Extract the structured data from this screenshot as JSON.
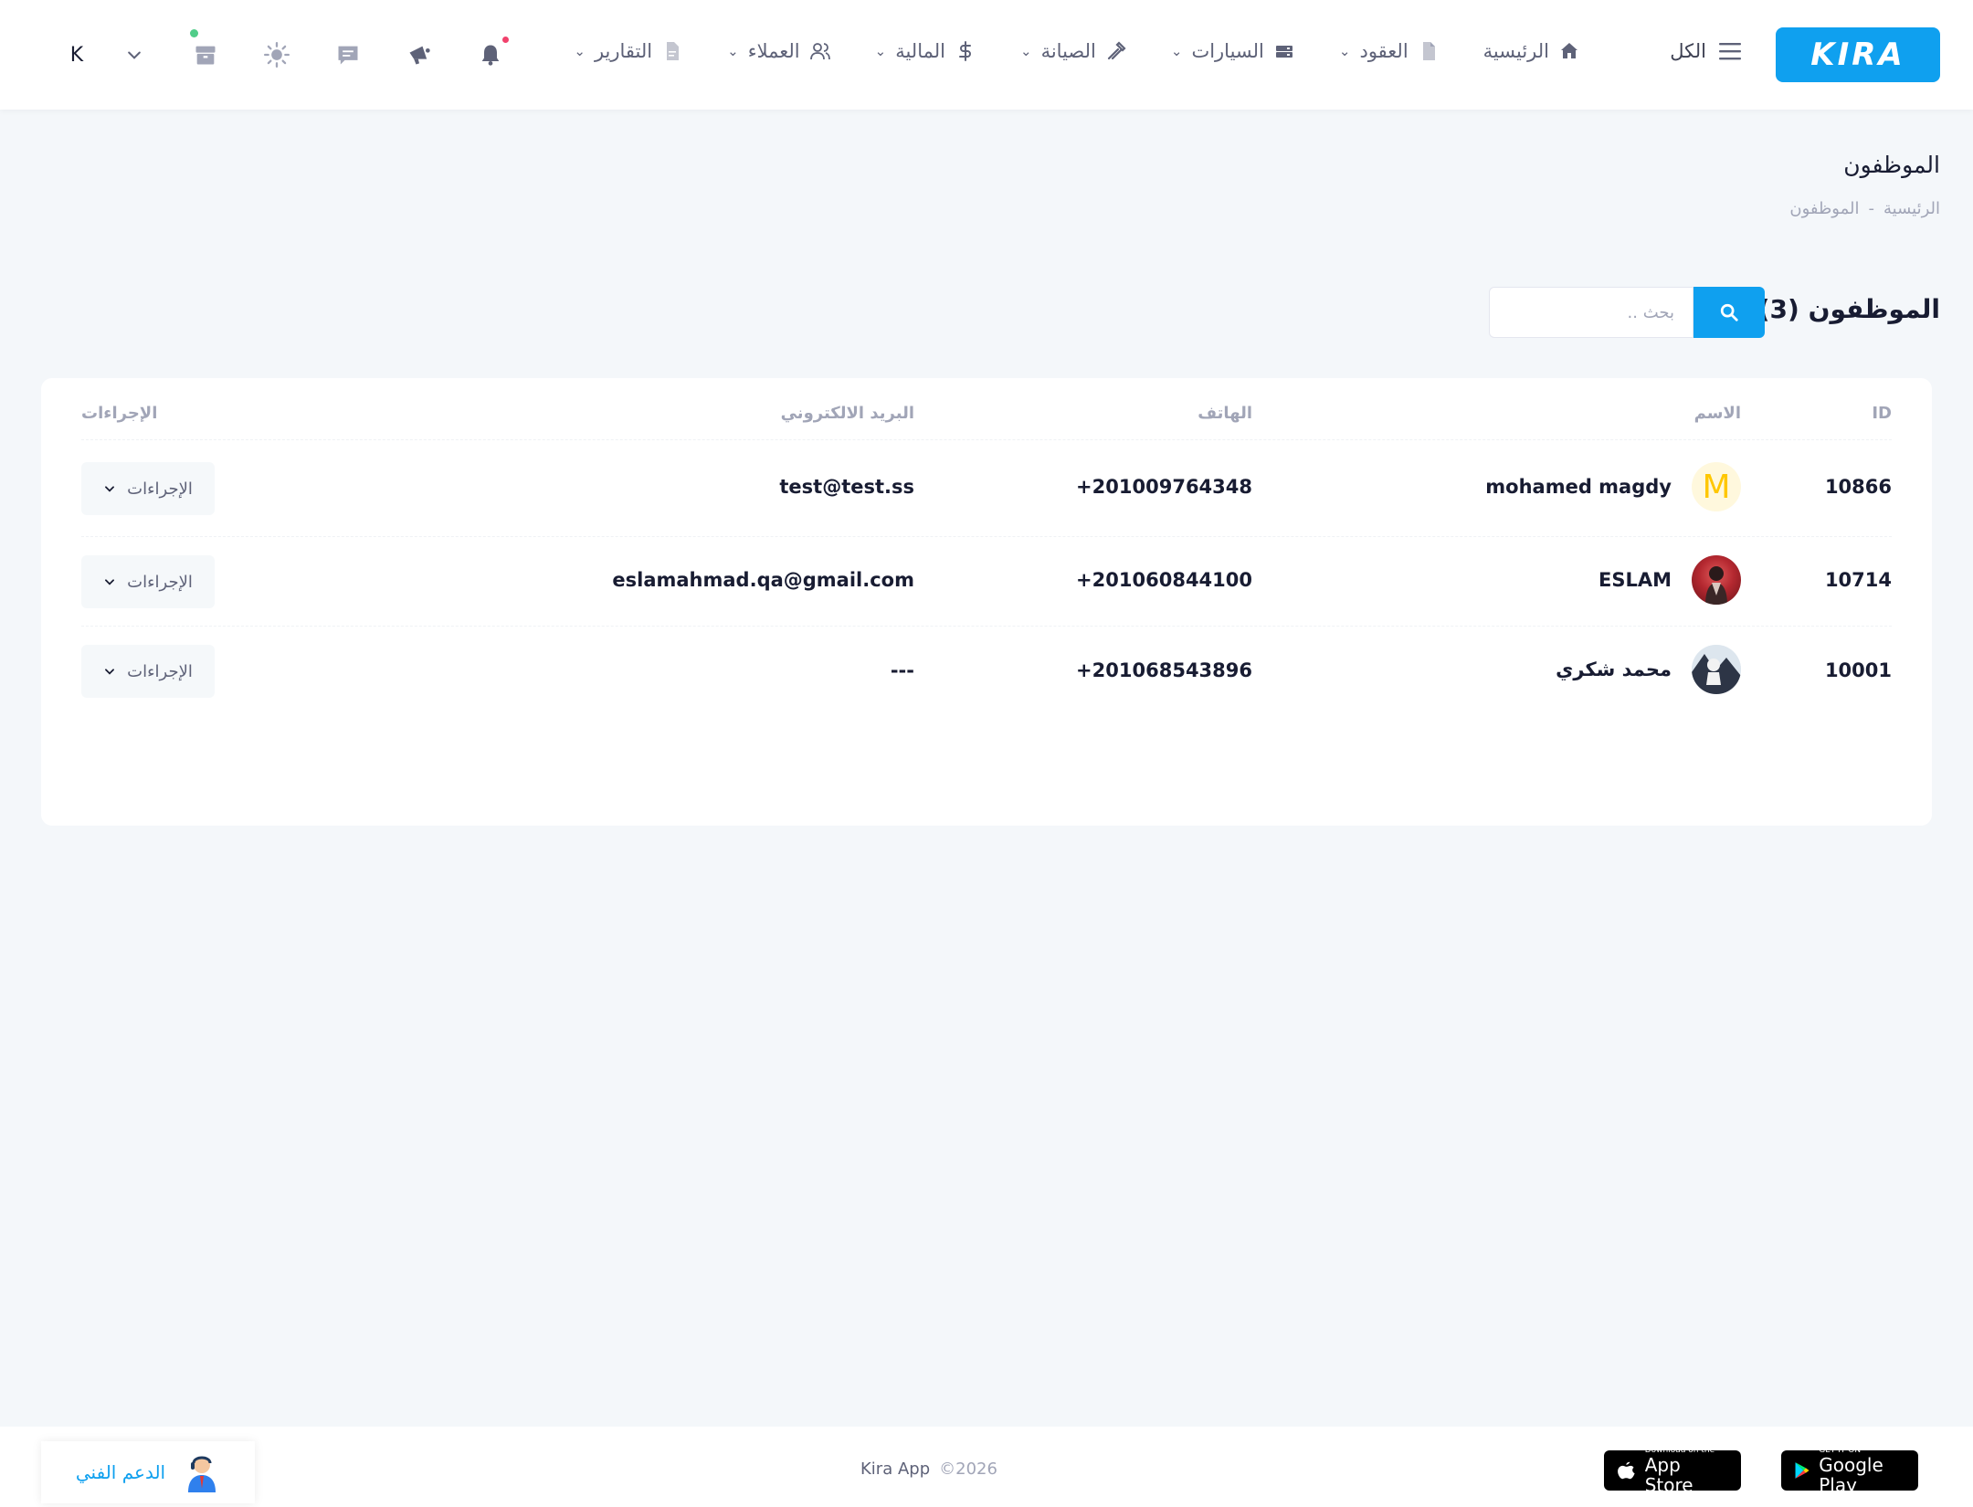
{
  "header": {
    "logo_text": "KIRA",
    "all_label": "الكل",
    "user_initial": "K",
    "nav": [
      {
        "label": "الرئيسية",
        "icon": "home-icon",
        "has_dropdown": false
      },
      {
        "label": "العقود",
        "icon": "document-icon",
        "has_dropdown": true
      },
      {
        "label": "السيارات",
        "icon": "car-icon",
        "has_dropdown": true
      },
      {
        "label": "الصيانة",
        "icon": "wrench-icon",
        "has_dropdown": true
      },
      {
        "label": "المالية",
        "icon": "dollar-icon",
        "has_dropdown": true
      },
      {
        "label": "العملاء",
        "icon": "users-icon",
        "has_dropdown": true
      },
      {
        "label": "التقارير",
        "icon": "report-icon",
        "has_dropdown": true
      }
    ],
    "icons": [
      "chevron-down-icon",
      "box-icon",
      "sun-icon",
      "chat-icon",
      "megaphone-icon",
      "bell-icon"
    ]
  },
  "page": {
    "title": "الموظفون",
    "breadcrumb": [
      "الرئيسية",
      "-",
      "الموظفون"
    ]
  },
  "toolbar": {
    "list_title": "الموظفون (3)",
    "search_placeholder": "بحث .."
  },
  "table": {
    "columns": {
      "id": "ID",
      "name": "الاسم",
      "phone": "الهاتف",
      "email": "البريد الالكتروني",
      "actions": "الإجراءات"
    },
    "rows": [
      {
        "id": "10866",
        "name": "mohamed magdy",
        "avatar_letter": "M",
        "phone": "201009764348+",
        "email": "test@test.ss",
        "action_label": "الإجراءات"
      },
      {
        "id": "10714",
        "name": "ESLAM",
        "avatar_letter": "",
        "phone": "201060844100+",
        "email": "eslamahmad.qa@gmail.com",
        "action_label": "الإجراءات"
      },
      {
        "id": "10001",
        "name": "محمد شكري",
        "avatar_letter": "",
        "phone": "201068543896+",
        "email": "---",
        "action_label": "الإجراءات"
      }
    ]
  },
  "footer": {
    "support_label": "الدعم الفني",
    "app_name": "Kira App",
    "year": "©2026",
    "google_small": "GET IT ON",
    "google_big": "Google Play",
    "apple_small": "Download on the",
    "apple_big": "App Store"
  },
  "colors": {
    "accent": "#0fa0ef",
    "background": "#f4f7fa",
    "bell_dot": "#f1416c",
    "online_dot": "#50cd89"
  }
}
